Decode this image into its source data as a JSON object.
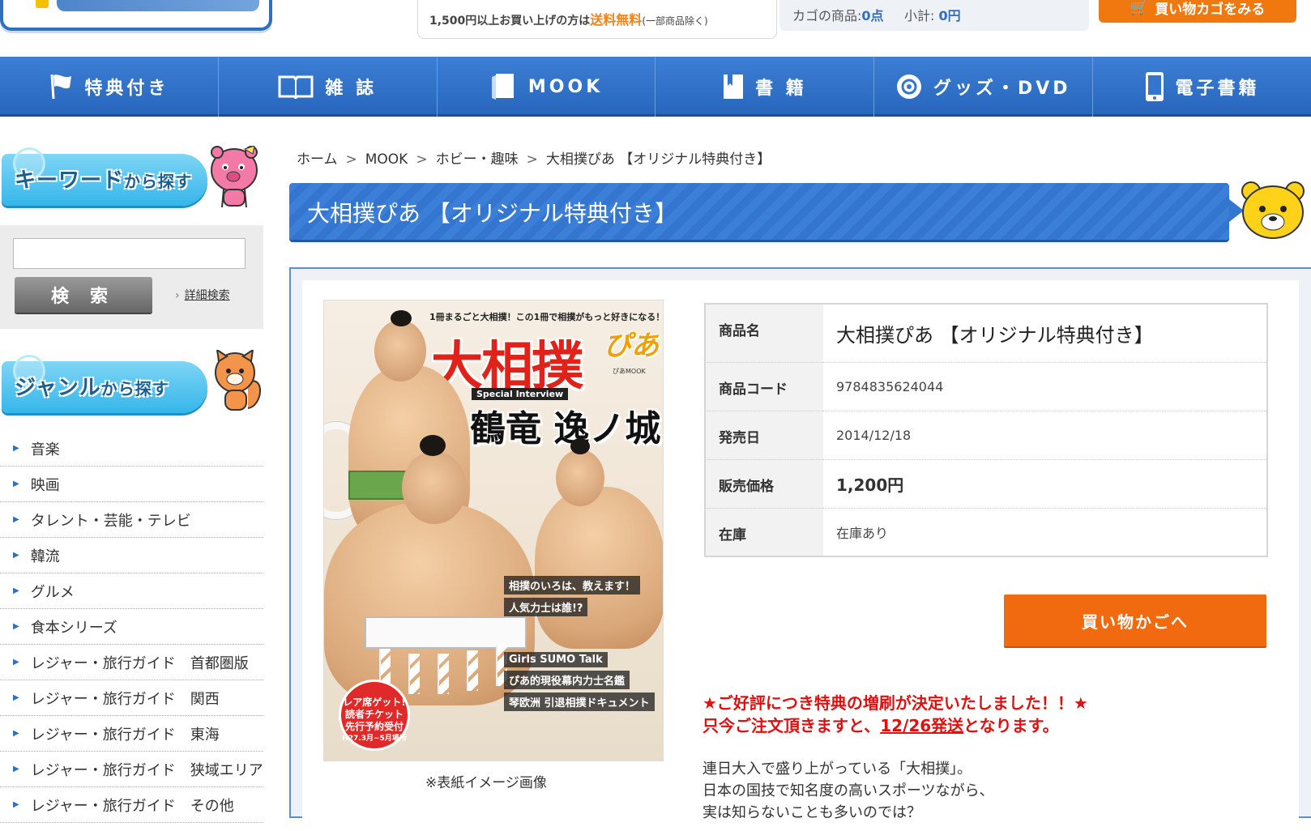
{
  "header": {
    "shipping_note_prefix": "1,500円以上お買い上げの方は",
    "shipping_free": "送料無料",
    "shipping_exclusion": "(一部商品除く)",
    "cart_items_label": "カゴの商品:",
    "cart_items_value": "0点",
    "cart_subtotal_label": "小計:",
    "cart_subtotal_value": "0円",
    "view_cart_label": "買い物カゴをみる"
  },
  "nav": {
    "items": [
      {
        "label": "特典付き",
        "icon": "flag-icon"
      },
      {
        "label": "雑 誌",
        "icon": "open-book-icon"
      },
      {
        "label": "MOOK",
        "icon": "mook-icon"
      },
      {
        "label": "書 籍",
        "icon": "book-icon"
      },
      {
        "label": "グッズ・DVD",
        "icon": "disc-icon"
      },
      {
        "label": "電子書籍",
        "icon": "smartphone-icon"
      }
    ]
  },
  "sidebar": {
    "keyword_banner": {
      "main": "キーワード",
      "suffix": "から探す"
    },
    "search_button": "検 索",
    "advanced_search": "詳細検索",
    "genre_banner": {
      "main": "ジャンル",
      "suffix": "から探す"
    },
    "genres": [
      "音楽",
      "映画",
      "タレント・芸能・テレビ",
      "韓流",
      "グルメ",
      "食本シリーズ",
      "レジャー・旅行ガイド　首都圏版",
      "レジャー・旅行ガイド　関西",
      "レジャー・旅行ガイド　東海",
      "レジャー・旅行ガイド　狭域エリア",
      "レジャー・旅行ガイド　その他"
    ]
  },
  "breadcrumb": [
    "ホーム",
    "MOOK",
    "ホビー・趣味",
    "大相撲ぴあ 【オリジナル特典付き】"
  ],
  "product": {
    "title": "大相撲ぴあ 【オリジナル特典付き】",
    "cover": {
      "tagline": "1冊まるごと大相撲！この1冊で相撲がもっと好きになる！",
      "masthead": "大相撲",
      "masthead_suffix": "ぴあ",
      "imprint": "ぴあMOOK",
      "interview_tag": "Special Interview",
      "headline": "鶴竜 逸ノ城",
      "lines": [
        "相撲のいろは、教えます！",
        "人気力士は誰!?",
        "Girls SUMO Talk",
        "ぴあ的現役幕内力士名鑑",
        "琴欧洲 引退相撲ドキュメント"
      ],
      "badge": [
        "レア席ゲット!",
        "読者チケット",
        "先行予約受付"
      ],
      "badge_small": "H27.3月~5月場所",
      "caption": "※表紙イメージ画像"
    },
    "specs": [
      {
        "label": "商品名",
        "value": "大相撲ぴあ 【オリジナル特典付き】"
      },
      {
        "label": "商品コード",
        "value": "9784835624044"
      },
      {
        "label": "発売日",
        "value": "2014/12/18"
      },
      {
        "label": "販売価格",
        "value": "1,200円"
      },
      {
        "label": "在庫",
        "value": "在庫あり"
      }
    ],
    "add_to_cart": "買い物かごへ",
    "notice_line1": "★ご好評につき特典の増刷が決定いたしました！！★",
    "notice_line2_prefix": "只今ご注文頂きますと、",
    "notice_line2_date": "12/26発送",
    "notice_line2_suffix": "となります。",
    "description": [
      "連日大入で盛り上がっている「大相撲」。",
      "日本の国技で知名度の高いスポーツながら、",
      "実は知らないことも多いのでは？"
    ]
  },
  "colors": {
    "nav_blue": "#2f6fc0",
    "accent_orange": "#f26a10",
    "notice_red": "#e01010",
    "banner_cyan": "#35b6ea"
  }
}
